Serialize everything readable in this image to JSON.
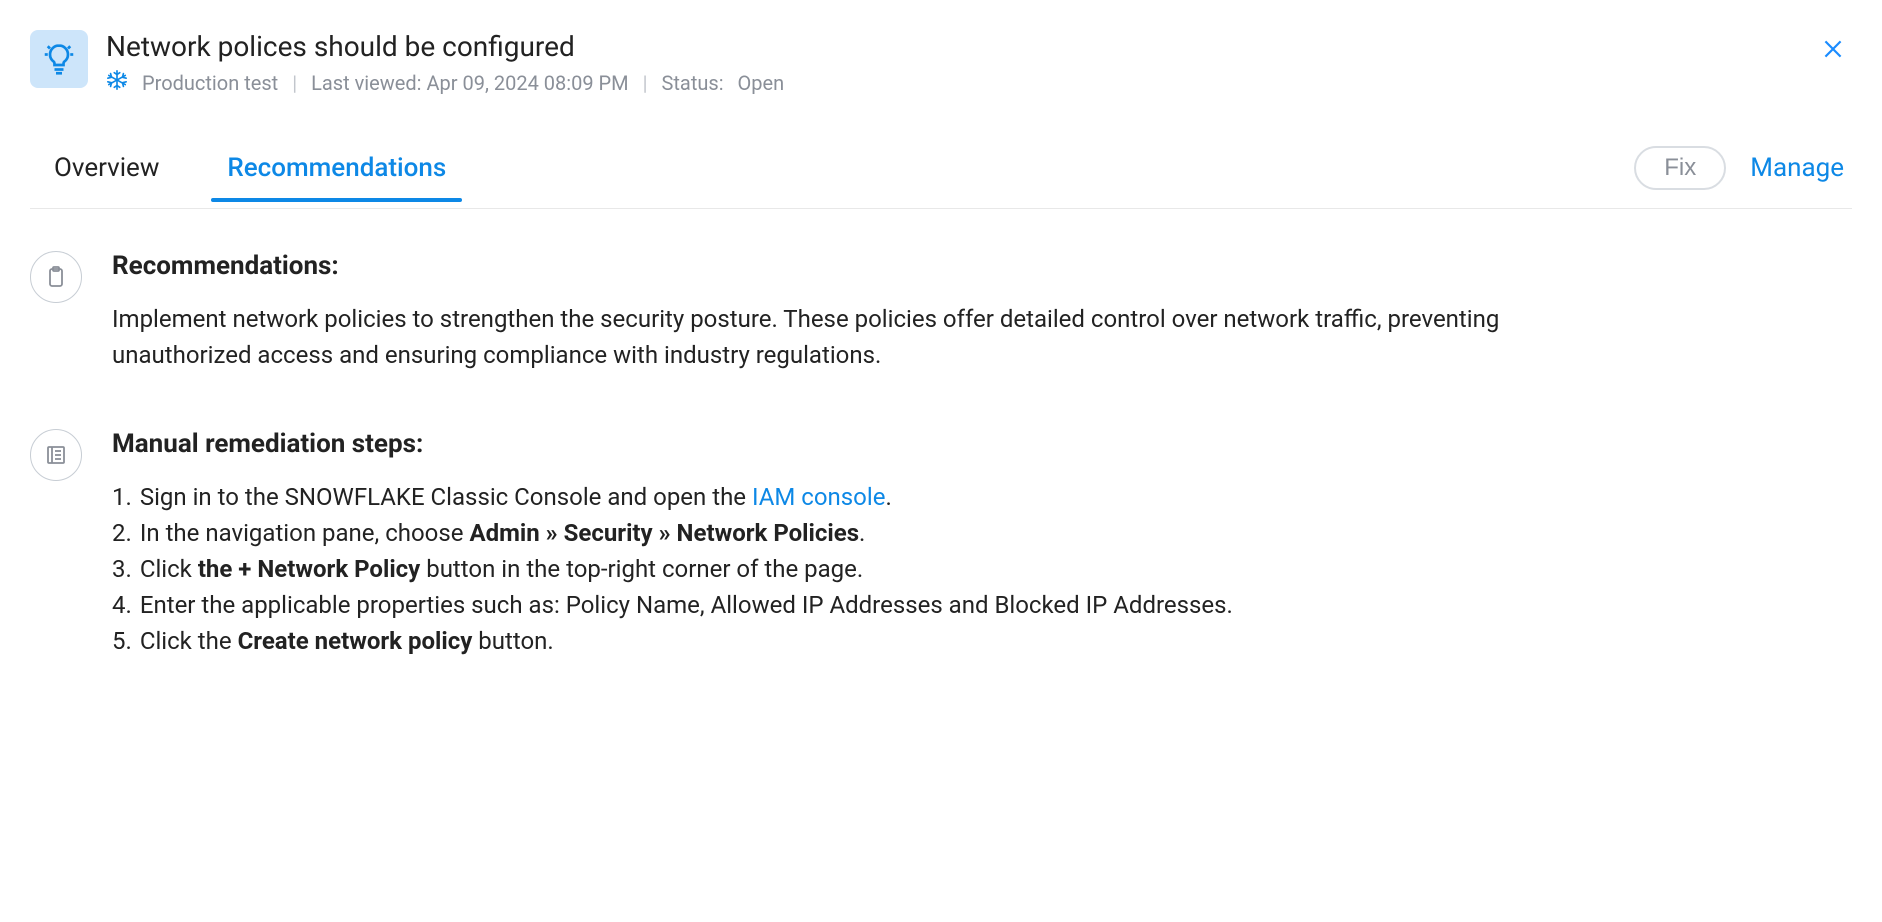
{
  "header": {
    "title": "Network polices should be configured",
    "environment": "Production test",
    "last_viewed_label": "Last viewed: Apr 09, 2024 08:09 PM",
    "status_label": "Status:",
    "status_value": "Open"
  },
  "tabs": {
    "overview": "Overview",
    "recommendations": "Recommendations"
  },
  "actions": {
    "fix": "Fix",
    "manage": "Manage"
  },
  "recommendations_section": {
    "title": "Recommendations:",
    "text": "Implement network policies to strengthen the security posture. These policies offer detailed control over network traffic, preventing unauthorized access and ensuring compliance with industry regulations."
  },
  "remediation_section": {
    "title": "Manual remediation steps:",
    "steps": {
      "s1_pre": "Sign in to the SNOWFLAKE Classic Console and open the ",
      "s1_link": "IAM console",
      "s1_post": ".",
      "s2_pre": "In the navigation pane, choose ",
      "s2_bold": "Admin » Security » Network Policies",
      "s2_post": ".",
      "s3_pre": "Click ",
      "s3_bold": "the + Network Policy",
      "s3_post": " button in the top-right corner of the page.",
      "s4": "Enter the applicable properties such as: Policy Name, Allowed IP Addresses and Blocked IP Addresses.",
      "s5_pre": "Click the ",
      "s5_bold": "Create network policy",
      "s5_post": " button."
    },
    "numbers": {
      "n1": "1.",
      "n2": "2.",
      "n3": "3.",
      "n4": "4.",
      "n5": "5."
    }
  }
}
